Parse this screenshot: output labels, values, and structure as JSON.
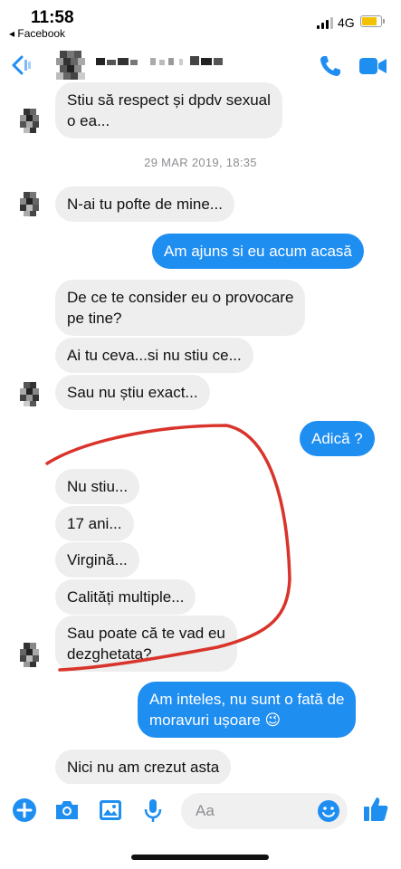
{
  "status_bar": {
    "time": "11:58",
    "back_app": "◂ Facebook",
    "network": "4G",
    "battery_color": "#f2c200"
  },
  "header": {
    "back_icon": "chevron-left-icon",
    "call_icon": "phone-icon",
    "video_icon": "video-camera-icon",
    "accent_color": "#1f8ef1"
  },
  "conversation": {
    "timestamp": "29 MAR 2019, 18:35",
    "messages": [
      {
        "side": "incoming",
        "text_lines": [
          "Stiu să respect și dpdv sexual",
          "o ea..."
        ]
      },
      {
        "side": "incoming",
        "text_lines": [
          "N-ai tu pofte de mine..."
        ]
      },
      {
        "side": "outgoing",
        "text_lines": [
          "Am ajuns si eu acum acasă"
        ]
      },
      {
        "side": "incoming",
        "text_lines": [
          "De ce te consider eu o provocare",
          "pe tine?"
        ]
      },
      {
        "side": "incoming",
        "text_lines": [
          "Ai tu ceva...si nu stiu ce..."
        ]
      },
      {
        "side": "incoming",
        "text_lines": [
          "Sau nu știu exact..."
        ]
      },
      {
        "side": "outgoing",
        "text_lines": [
          "Adică ?"
        ]
      },
      {
        "side": "incoming",
        "text_lines": [
          "Nu stiu..."
        ]
      },
      {
        "side": "incoming",
        "text_lines": [
          "17 ani..."
        ]
      },
      {
        "side": "incoming",
        "text_lines": [
          "Virgină..."
        ]
      },
      {
        "side": "incoming",
        "text_lines": [
          "Calități multiple..."
        ]
      },
      {
        "side": "incoming",
        "text_lines": [
          "Sau poate că te vad eu",
          "dezghetata?"
        ]
      },
      {
        "side": "outgoing",
        "text_lines": [
          "Am inteles, nu sunt o fată de",
          "moravuri ușoare 😉"
        ]
      },
      {
        "side": "incoming",
        "text_lines": [
          "Nici nu am crezut asta"
        ]
      }
    ]
  },
  "annotation": {
    "color": "#d9342b"
  },
  "composer": {
    "placeholder": "Aa",
    "tools": [
      "plus-icon",
      "camera-icon",
      "photo-icon",
      "microphone-icon"
    ],
    "emoji_icon": "smiley-icon",
    "like_icon": "thumbs-up-icon"
  }
}
